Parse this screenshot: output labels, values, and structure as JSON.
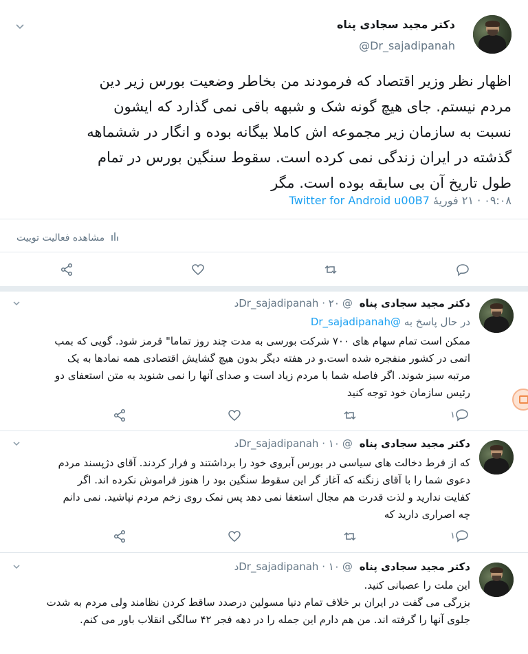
{
  "main_tweet": {
    "author_name": "دکتر مجید سجادی پناه",
    "handle": "@Dr_sajadipanah",
    "text_lines": [
      "اظهار نظر وزیر اقتصاد که فرمودند من بخاطر وضعیت بورس زیر دین",
      "مردم نیستم. جای هیچ گونه شک و شبهه باقی نمی گذارد که ایشون",
      "نسبت به سازمان زیر مجموعه اش کاملا بیگانه بوده و انگار در ششماهه",
      "گذشته در ایران زندگی نمی کرده است. سقوط سنگین بورس در تمام",
      "طول تاریخ آن بی سابقه بوده است. مگر"
    ],
    "time": "۰۹:۰۸ ·",
    "date": "۲۱ فوریهٔ",
    "source": "Twitter for Android u00B7",
    "activity_label": "مشاهده فعالیت توییت"
  },
  "replies": [
    {
      "author_name": "دکتر مجید سجادی پناه",
      "handle": "@Dr_sajadipanah",
      "time": "۲۰د",
      "reply_to_label": "در حال پاسخ به",
      "reply_to_handle": "@Dr_sajadipanah",
      "text_lines": [
        "ممکن است تمام سهام های ۷۰۰ شرکت بورسی به مدت چند روز تماما\" قرمز شود. گویی که بمب",
        "اتمی در کشور منفجره شده است.و در هفته دیگر بدون هیچ گشایش اقتصادی همه نمادها به یک",
        "مرتبه سبز شوند. اگر فاصله شما با مردم زیاد است و صدای آنها را نمی شنوید به متن استعفای دو",
        "رئیس سازمان خود توجه کنید"
      ],
      "reply_count": "۱"
    },
    {
      "author_name": "دکتر مجید سجادی پناه",
      "handle": "@Dr_sajadipanah",
      "time": "۱۰د",
      "text_lines": [
        "که از فرط دخالت های سیاسی در بورس آبروی خود را برداشتند و فرار کردند. آقای دژپسند مردم",
        "دعوی شما را با آقای زنگنه که آغاز گر این سقوط سنگین بود را هنوز فراموش نکرده اند. اگر",
        "کفایت ندارید و لذت قدرت هم مجال استعفا نمی دهد پس نمک روی زخم مردم نپاشید. نمی دانم",
        "چه اصراری دارید که"
      ],
      "reply_count": "۱"
    },
    {
      "author_name": "دکتر مجید سجادی پناه",
      "handle": "@Dr_sajadipanah",
      "time": "۱۰د",
      "text_lines": [
        "این ملت را عصبانی کنید.",
        "بزرگی می گفت در ایران بر خلاف تمام دنیا مسولین درصدد ساقط کردن نظامند ولی مردم به شدت",
        "جلوی آنها را گرفته اند. من هم دارم این جمله را در دهه فجر ۴۲ سالگی انقلاب باور می کنم."
      ]
    }
  ],
  "colors": {
    "accent": "#1da1f2",
    "secondary_text": "#657786",
    "divider": "#e1e8ed"
  }
}
